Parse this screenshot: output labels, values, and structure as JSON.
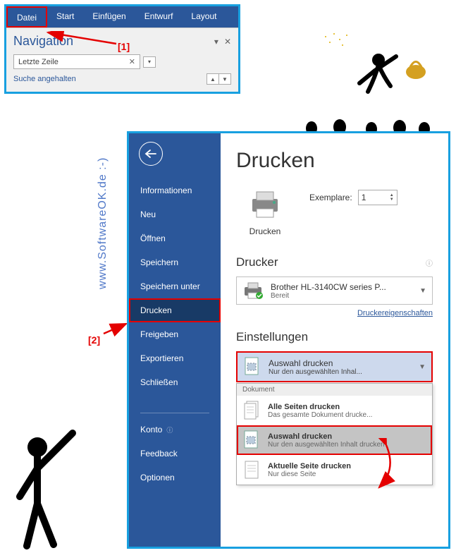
{
  "ribbon": {
    "tabs": [
      "Datei",
      "Start",
      "Einfügen",
      "Entwurf",
      "Layout"
    ]
  },
  "navigation": {
    "title": "Navigation",
    "search_value": "Letzte Zeile",
    "status": "Suche angehalten"
  },
  "markers": {
    "one": "[1]",
    "two": "[2]"
  },
  "watermark": "www.SoftwareOK.de :-)",
  "sidebar": {
    "items": [
      {
        "label": "Informationen"
      },
      {
        "label": "Neu"
      },
      {
        "label": "Öffnen"
      },
      {
        "label": "Speichern"
      },
      {
        "label": "Speichern unter"
      },
      {
        "label": "Drucken",
        "active": true
      },
      {
        "label": "Freigeben"
      },
      {
        "label": "Exportieren"
      },
      {
        "label": "Schließen"
      }
    ],
    "bottom": [
      {
        "label": "Konto"
      },
      {
        "label": "Feedback"
      },
      {
        "label": "Optionen"
      }
    ]
  },
  "print": {
    "title": "Drucken",
    "button": "Drucken",
    "copies_label": "Exemplare:",
    "copies_value": "1",
    "printer_header": "Drucker",
    "printer_name": "Brother HL-3140CW series P...",
    "printer_status": "Bereit",
    "printer_props": "Druckereigenschaften",
    "settings_header": "Einstellungen",
    "selected": {
      "label": "Auswahl drucken",
      "sub": "Nur den ausgewählten Inhal..."
    },
    "dropdown_group": "Dokument",
    "options": [
      {
        "label": "Alle Seiten drucken",
        "sub": "Das gesamte Dokument drucke..."
      },
      {
        "label": "Auswahl drucken",
        "sub": "Nur den ausgewählten Inhalt drucken",
        "selected": true
      },
      {
        "label": "Aktuelle Seite drucken",
        "sub": "Nur diese Seite"
      }
    ]
  }
}
